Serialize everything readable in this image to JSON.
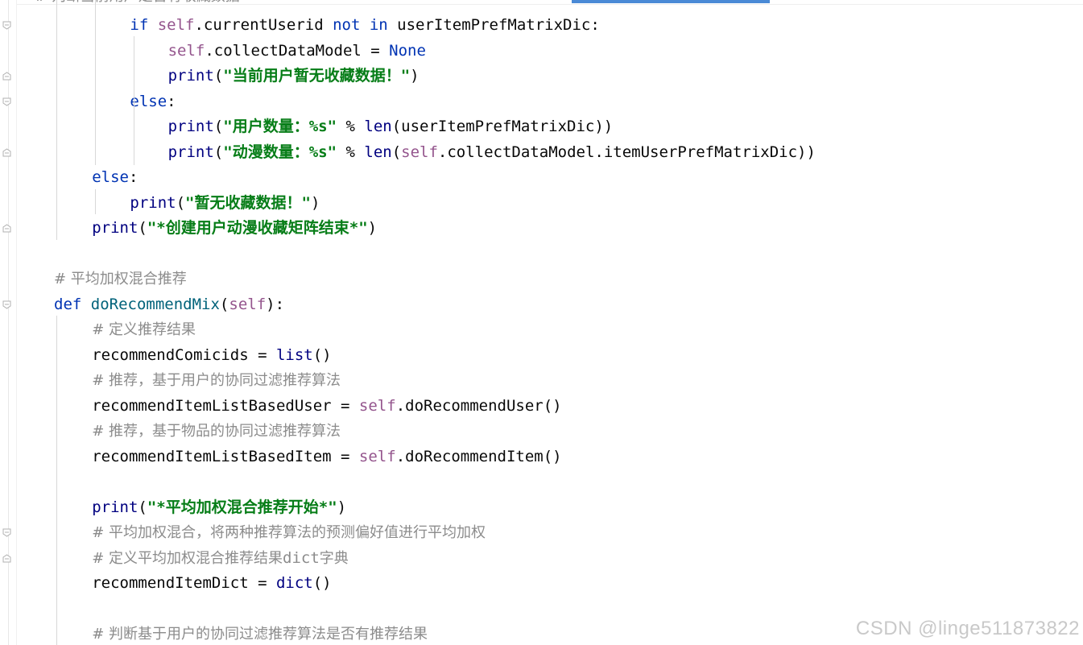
{
  "editor": {
    "partial_top": "    # 判断当前用户是否有收藏数据",
    "lines": [
      {
        "indent": "        ",
        "parts": [
          [
            "kw",
            "if "
          ],
          [
            "self",
            "self"
          ],
          [
            "plain",
            ".currentUserid "
          ],
          [
            "kw",
            "not in "
          ],
          [
            "plain",
            "userItemPrefMatrixDic:"
          ]
        ]
      },
      {
        "indent": "            ",
        "parts": [
          [
            "self",
            "self"
          ],
          [
            "plain",
            ".collectDataModel = "
          ],
          [
            "kw",
            "None"
          ]
        ]
      },
      {
        "indent": "            ",
        "parts": [
          [
            "bi",
            "print"
          ],
          [
            "plain",
            "("
          ],
          [
            "str",
            "\""
          ],
          [
            "strcn",
            "当前用户暂无收藏数据！"
          ],
          [
            "str",
            "\""
          ],
          [
            "plain",
            ")"
          ]
        ]
      },
      {
        "indent": "        ",
        "parts": [
          [
            "kw",
            "else"
          ],
          [
            "plain",
            ":"
          ]
        ]
      },
      {
        "indent": "            ",
        "parts": [
          [
            "bi",
            "print"
          ],
          [
            "plain",
            "("
          ],
          [
            "str",
            "\""
          ],
          [
            "strcn",
            "用户数量："
          ],
          [
            "str",
            "%s\""
          ],
          [
            "plain",
            " % "
          ],
          [
            "bi",
            "len"
          ],
          [
            "plain",
            "(userItemPrefMatrixDic))"
          ]
        ]
      },
      {
        "indent": "            ",
        "parts": [
          [
            "bi",
            "print"
          ],
          [
            "plain",
            "("
          ],
          [
            "str",
            "\""
          ],
          [
            "strcn",
            "动漫数量："
          ],
          [
            "str",
            "%s\""
          ],
          [
            "plain",
            " % "
          ],
          [
            "bi",
            "len"
          ],
          [
            "plain",
            "("
          ],
          [
            "self",
            "self"
          ],
          [
            "plain",
            ".collectDataModel.itemUserPrefMatrixDic))"
          ]
        ]
      },
      {
        "indent": "    ",
        "parts": [
          [
            "kw",
            "else"
          ],
          [
            "plain",
            ":"
          ]
        ]
      },
      {
        "indent": "        ",
        "parts": [
          [
            "bi",
            "print"
          ],
          [
            "plain",
            "("
          ],
          [
            "str",
            "\""
          ],
          [
            "strcn",
            "暂无收藏数据！"
          ],
          [
            "str",
            "\""
          ],
          [
            "plain",
            ")"
          ]
        ]
      },
      {
        "indent": "    ",
        "parts": [
          [
            "bi",
            "print"
          ],
          [
            "plain",
            "("
          ],
          [
            "str",
            "\"*"
          ],
          [
            "strcn",
            "创建用户动漫收藏矩阵结束"
          ],
          [
            "str",
            "*\""
          ],
          [
            "plain",
            ")"
          ]
        ]
      },
      {
        "indent": "",
        "parts": []
      },
      {
        "indent": "",
        "parts": [
          [
            "cm",
            "# 平均加权混合推荐"
          ]
        ]
      },
      {
        "indent": "",
        "parts": [
          [
            "kw",
            "def "
          ],
          [
            "fn",
            "doRecommendMix"
          ],
          [
            "plain",
            "("
          ],
          [
            "self",
            "self"
          ],
          [
            "plain",
            "):"
          ]
        ]
      },
      {
        "indent": "    ",
        "parts": [
          [
            "cm",
            "# 定义推荐结果"
          ]
        ]
      },
      {
        "indent": "    ",
        "parts": [
          [
            "plain",
            "recommendComicids = "
          ],
          [
            "bi",
            "list"
          ],
          [
            "plain",
            "()"
          ]
        ]
      },
      {
        "indent": "    ",
        "parts": [
          [
            "cm",
            "# 推荐，基于用户的协同过滤推荐算法"
          ]
        ]
      },
      {
        "indent": "    ",
        "parts": [
          [
            "plain",
            "recommendItemListBasedUser = "
          ],
          [
            "self",
            "self"
          ],
          [
            "plain",
            ".doRecommendUser()"
          ]
        ]
      },
      {
        "indent": "    ",
        "parts": [
          [
            "cm",
            "# 推荐，基于物品的协同过滤推荐算法"
          ]
        ]
      },
      {
        "indent": "    ",
        "parts": [
          [
            "plain",
            "recommendItemListBasedItem = "
          ],
          [
            "self",
            "self"
          ],
          [
            "plain",
            ".doRecommendItem()"
          ]
        ]
      },
      {
        "indent": "",
        "parts": []
      },
      {
        "indent": "    ",
        "parts": [
          [
            "bi",
            "print"
          ],
          [
            "plain",
            "("
          ],
          [
            "str",
            "\"*"
          ],
          [
            "strcn",
            "平均加权混合推荐开始"
          ],
          [
            "str",
            "*\""
          ],
          [
            "plain",
            ")"
          ]
        ]
      },
      {
        "indent": "    ",
        "parts": [
          [
            "cm",
            "# 平均加权混合，将两种推荐算法的预测偏好值进行平均加权"
          ]
        ]
      },
      {
        "indent": "    ",
        "parts": [
          [
            "cm",
            "# 定义平均加权混合推荐结果"
          ],
          [
            "cmmono",
            "dict"
          ],
          [
            "cm",
            "字典"
          ]
        ]
      },
      {
        "indent": "    ",
        "parts": [
          [
            "plain",
            "recommendItemDict = "
          ],
          [
            "bi",
            "dict"
          ],
          [
            "plain",
            "()"
          ]
        ]
      },
      {
        "indent": "",
        "parts": []
      },
      {
        "indent": "    ",
        "parts": [
          [
            "cm",
            "# 判断基于用户的协同过滤推荐算法是否有推荐结果"
          ]
        ]
      }
    ]
  },
  "watermark": "CSDN @linge511873822",
  "icons": {
    "fold_open": "fold-open-icon",
    "fold_end": "fold-end-icon"
  }
}
